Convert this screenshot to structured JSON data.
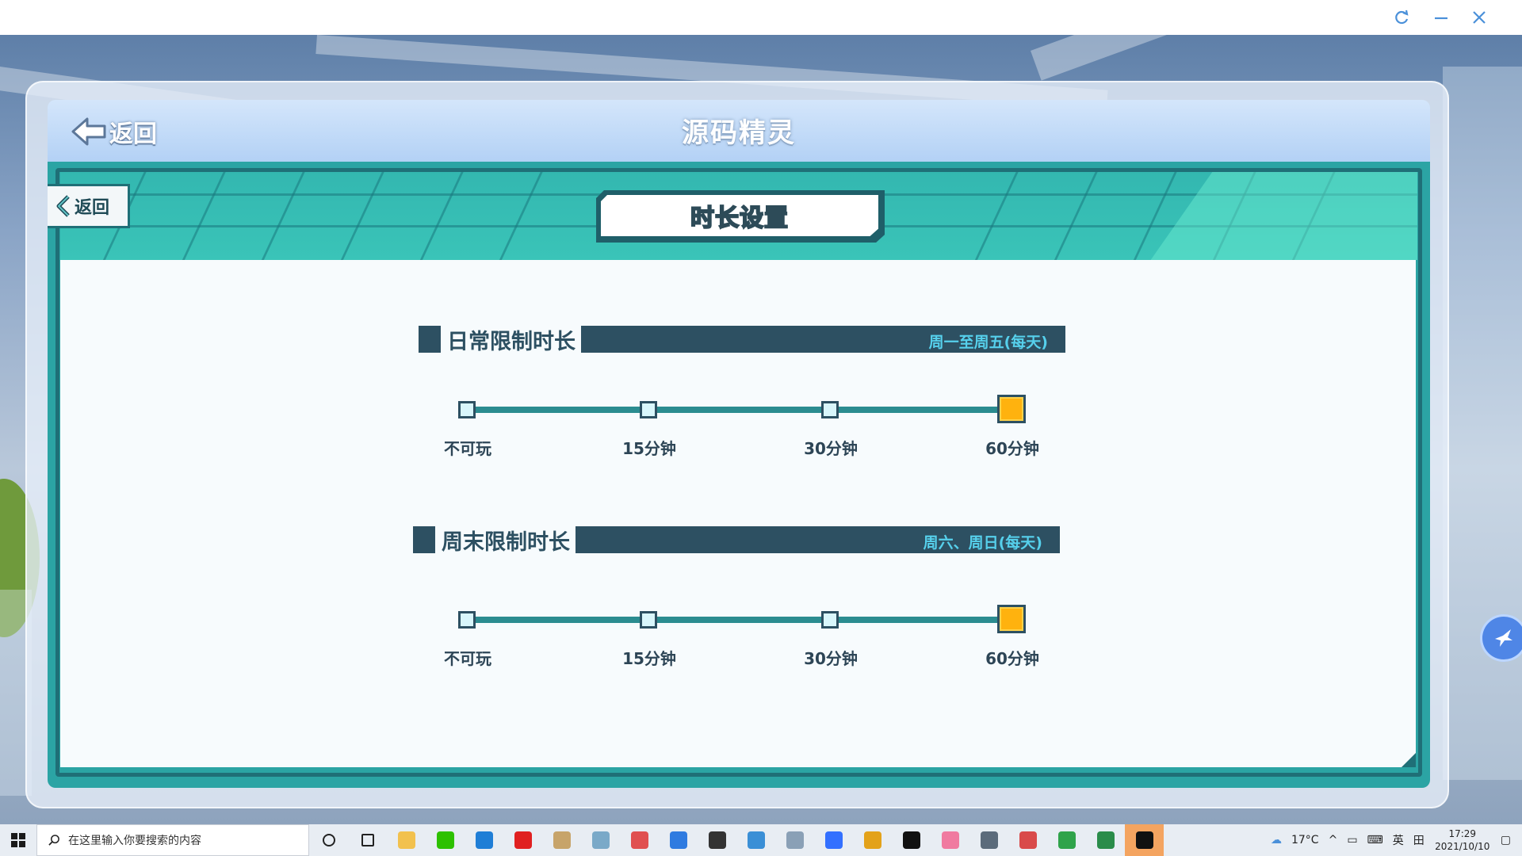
{
  "window": {
    "controls": [
      "refresh-icon",
      "minimize-icon",
      "close-icon"
    ]
  },
  "app": {
    "title": "源码精灵",
    "back_label": "返回"
  },
  "panel": {
    "back_label": "返回",
    "section_title": "时长设置"
  },
  "settings": [
    {
      "label": "日常限制时长",
      "days": "周一至周五(每天)",
      "options": [
        "不可玩",
        "15分钟",
        "30分钟",
        "60分钟"
      ],
      "selected_index": 3
    },
    {
      "label": "周末限制时长",
      "days": "周六、周日(每天)",
      "options": [
        "不可玩",
        "15分钟",
        "30分钟",
        "60分钟"
      ],
      "selected_index": 3
    }
  ],
  "taskbar": {
    "search_placeholder": "在这里输入你要搜索的内容",
    "weather": "17°C",
    "ime": "英",
    "time": "17:29",
    "date": "2021/10/10",
    "apps": [
      {
        "name": "cortana-icon",
        "color": "#222222"
      },
      {
        "name": "task-view-icon",
        "color": "#222222"
      },
      {
        "name": "file-explorer-icon",
        "color": "#f2c14e"
      },
      {
        "name": "wechat-icon",
        "color": "#2dc100"
      },
      {
        "name": "edge-icon",
        "color": "#1f7ed6"
      },
      {
        "name": "youdao-icon",
        "color": "#e02020"
      },
      {
        "name": "paint-icon",
        "color": "#c7a46a"
      },
      {
        "name": "notes-icon",
        "color": "#7aa9c8"
      },
      {
        "name": "mascot-app-icon",
        "color": "#e05050"
      },
      {
        "name": "k-app-icon",
        "color": "#2f7be0"
      },
      {
        "name": "settings-icon",
        "color": "#333333"
      },
      {
        "name": "remote-desktop-icon",
        "color": "#3a8fd6"
      },
      {
        "name": "photos-icon",
        "color": "#8aa0b6"
      },
      {
        "name": "feishu-icon",
        "color": "#3370ff"
      },
      {
        "name": "chrome-icon",
        "color": "#e3a21a"
      },
      {
        "name": "terminal-icon",
        "color": "#111111"
      },
      {
        "name": "game-icon",
        "color": "#f07aa0"
      },
      {
        "name": "calculator-icon",
        "color": "#5b6b7b"
      },
      {
        "name": "source-genie-icon",
        "color": "#d94a4a"
      },
      {
        "name": "browser-icon",
        "color": "#2fa34a"
      },
      {
        "name": "globe-icon",
        "color": "#2a8c4a"
      },
      {
        "name": "qq-icon",
        "color": "#111111"
      }
    ],
    "active_app_index": 21
  }
}
